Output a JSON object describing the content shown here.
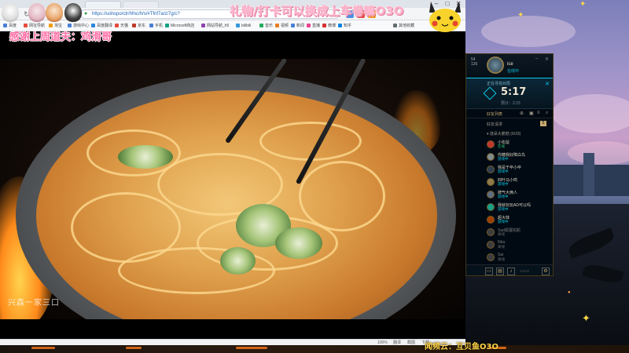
{
  "browser": {
    "url": "https://udnspo/ctr/hfnc/h/s/#Tfnf7a/z/7g/c?",
    "bookmarks": [
      "百度",
      "网址导航",
      "淘宝",
      "游戏中心",
      "百度翻译",
      "天猫",
      "京东",
      "手机",
      "Microsoft商店",
      "网站导航_h5",
      "bilibili",
      "音乐",
      "视频",
      "新闻",
      "直播",
      "微博",
      "知乎",
      "其他收藏"
    ],
    "status_items": [
      "100%",
      "翻译",
      "截图",
      "下载"
    ]
  },
  "overlay": {
    "gift_text": "礼物/打卡可以换成上车卷嘛O3O",
    "thanks_text": "感谢上周道夫：鸡滑哥",
    "watermark": "兴森一家三口",
    "qq_text": "闻频云：互贝鱼O3O"
  },
  "client": {
    "level_a": "54",
    "level_b": "126",
    "profile_name": "ice",
    "profile_status": "在线中",
    "queue_label": "正在寻找对局",
    "queue_timer": "5:17",
    "queue_sub": "预计：2:15",
    "friends_header": "好友列表",
    "invites_label": "好友请求",
    "invites_count": "5",
    "group_label": "▾ 逸朵大鹏勃 (6/33)",
    "friends": [
      {
        "name": "小松鼠",
        "status": "在线",
        "kind": "green"
      },
      {
        "name": "你糖我好障白鸟",
        "status": "游戏中",
        "kind": "cyan"
      },
      {
        "name": "我是于卒小卒",
        "status": "游戏中",
        "kind": "cyan"
      },
      {
        "name": "四叶马小鸣",
        "status": "游戏中",
        "kind": "cyan"
      },
      {
        "name": "牌气大俩人",
        "status": "游戏中",
        "kind": "cyan"
      },
      {
        "name": "我就玩玩AD可以吗",
        "status": "游戏中",
        "kind": "cyan"
      },
      {
        "name": "超大妹",
        "status": "游戏中",
        "kind": "cyan"
      },
      {
        "name": "Sad狐狸完颜",
        "status": "离线",
        "kind": "gray"
      },
      {
        "name": "Nba",
        "status": "离线",
        "kind": "gray"
      },
      {
        "name": "Sai",
        "status": "离线",
        "kind": "gray"
      }
    ],
    "version": "V12.8"
  },
  "colors": {
    "lol_gold": "#c8aa6e",
    "lol_cyan": "#0acbe6",
    "gift_pink": "#ffb1c9"
  }
}
